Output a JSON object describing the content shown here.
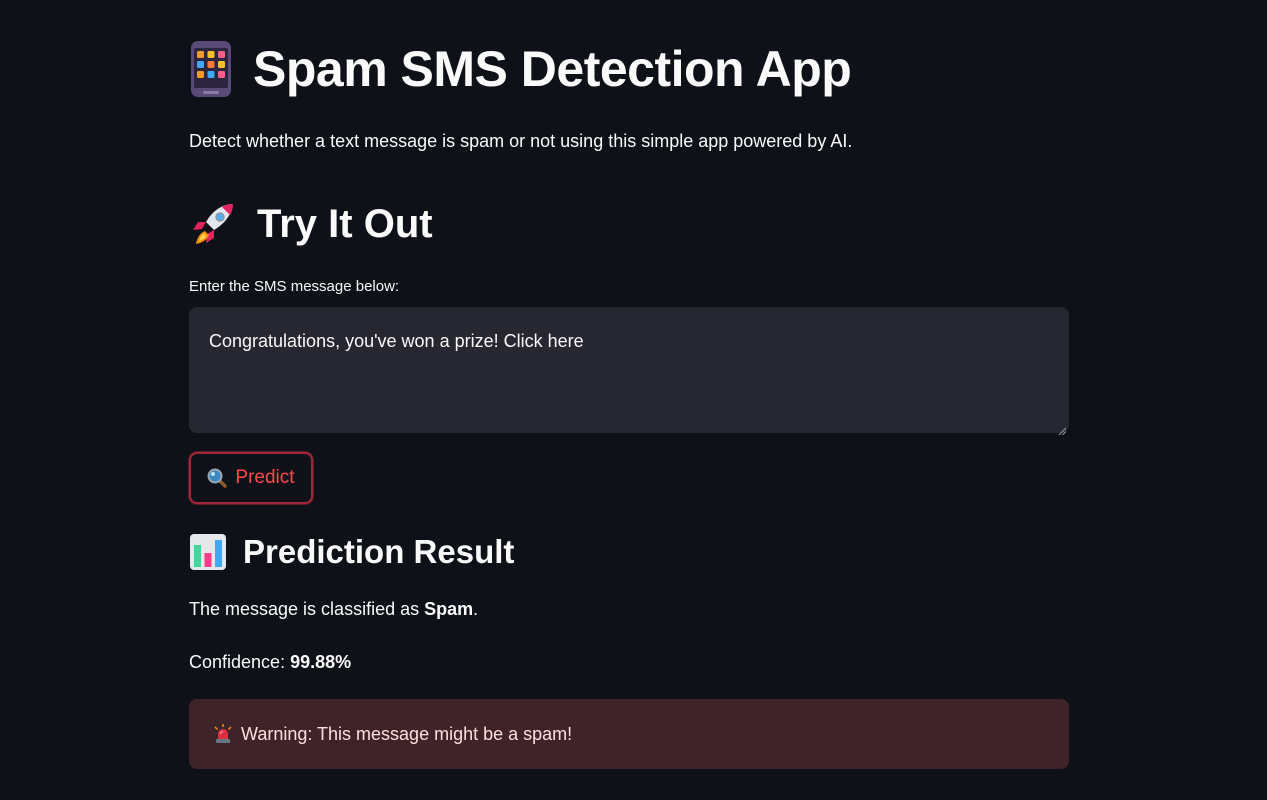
{
  "header": {
    "title": "Spam SMS Detection App",
    "title_icon": "mobile-phone-icon",
    "description": "Detect whether a text message is spam or not using this simple app powered by AI."
  },
  "try_section": {
    "heading": "Try It Out",
    "heading_icon": "rocket-icon",
    "input_label": "Enter the SMS message below:",
    "input_value": "Congratulations, you've won a prize! Click here",
    "predict_label": "Predict",
    "predict_icon": "magnifier-icon"
  },
  "result_section": {
    "heading": "Prediction Result",
    "heading_icon": "bar-chart-icon",
    "classified_prefix": "The message is classified as ",
    "classified_value": "Spam",
    "classified_suffix": ".",
    "confidence_prefix": "Confidence: ",
    "confidence_value": "99.88%",
    "warning_text": "Warning: This message might be a spam!",
    "warning_icon": "siren-icon"
  },
  "colors": {
    "background": "#0e1117",
    "input_bg": "#262730",
    "accent": "#ff4b4b",
    "warning_bg": "#3e2428"
  }
}
